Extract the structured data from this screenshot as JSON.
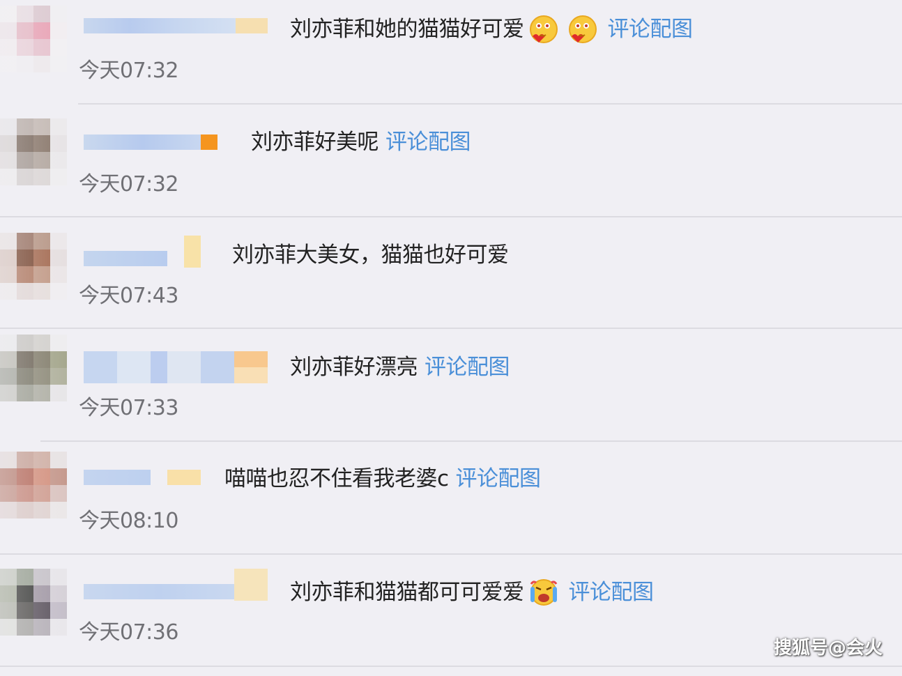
{
  "comments": [
    {
      "text": "刘亦菲和她的猫猫好可爱",
      "emojis": [
        "heart-smile-emoji",
        "heart-smile-emoji"
      ],
      "link": "评论配图",
      "time": "今天07:32"
    },
    {
      "text": "刘亦菲好美呢",
      "emojis": [],
      "link": "评论配图",
      "time": "今天07:32"
    },
    {
      "text": "刘亦菲大美女，猫猫也好可爱",
      "emojis": [],
      "link": "",
      "time": "今天07:43"
    },
    {
      "text": "刘亦菲好漂亮",
      "emojis": [],
      "link": "评论配图",
      "time": "今天07:33"
    },
    {
      "text": "喵喵也忍不住看我老婆c",
      "emojis": [],
      "link": "评论配图",
      "time": "今天08:10"
    },
    {
      "text": "刘亦菲和猫猫都可可爱爱",
      "emojis": [
        "crying-laugh-emoji"
      ],
      "link": "评论配图",
      "time": "今天07:36"
    }
  ],
  "watermark": "搜狐号@会火",
  "colors": {
    "background": "#f0eff4",
    "link": "#4a8fd8",
    "text": "#222222",
    "time": "#707075",
    "divider": "#dcdbe1"
  }
}
